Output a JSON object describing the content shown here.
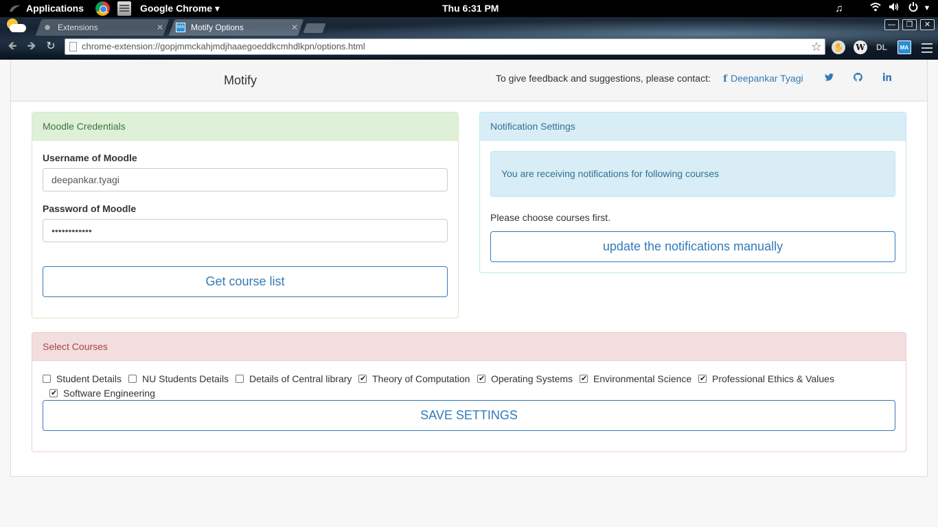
{
  "system_bar": {
    "applications_label": "Applications",
    "app_menu_label": "Google Chrome ▾",
    "clock": "Thu  6:31 PM",
    "tray_icons": [
      "music-icon",
      "wifi-icon",
      "volume-icon",
      "power-icon"
    ]
  },
  "browser": {
    "tabs": [
      {
        "label": "Extensions",
        "active": false
      },
      {
        "label": "Motify Options",
        "active": true
      }
    ],
    "url": "chrome-extension://gopjmmckahjmdjhaaegoeddkcmhdlkpn/options.html",
    "extension_icons": [
      "stop-icon",
      "wikipedia-icon",
      "dl-icon",
      "motify-icon"
    ]
  },
  "header": {
    "brand": "Motify",
    "contact_text": "To give feedback and suggestions, please contact:",
    "author_link": "Deepankar Tyagi",
    "social_icons": [
      "twitter-icon",
      "github-icon",
      "linkedin-icon"
    ]
  },
  "moodle_panel": {
    "title": "Moodle Credentials",
    "username_label": "Username of Moodle",
    "username_value": "deepankar.tyagi",
    "password_label": "Password of Moodle",
    "password_value": "••••••••••••",
    "button_label": "Get course list"
  },
  "notification_panel": {
    "title": "Notification Settings",
    "alert_text": "You are receiving notifications for following courses",
    "empty_text": "Please choose courses first.",
    "button_label": "update the notifications manually"
  },
  "courses_panel": {
    "title": "Select Courses",
    "courses": [
      {
        "label": "Student Details",
        "checked": false
      },
      {
        "label": "NU Students Details",
        "checked": false
      },
      {
        "label": "Details of Central library",
        "checked": false
      },
      {
        "label": "Theory of Computation",
        "checked": true
      },
      {
        "label": "Operating Systems",
        "checked": true
      },
      {
        "label": "Environmental Science",
        "checked": true
      },
      {
        "label": "Professional Ethics & Values",
        "checked": true
      },
      {
        "label": "Software Engineering",
        "checked": true
      }
    ],
    "button_label": "SAVE SETTINGS"
  }
}
